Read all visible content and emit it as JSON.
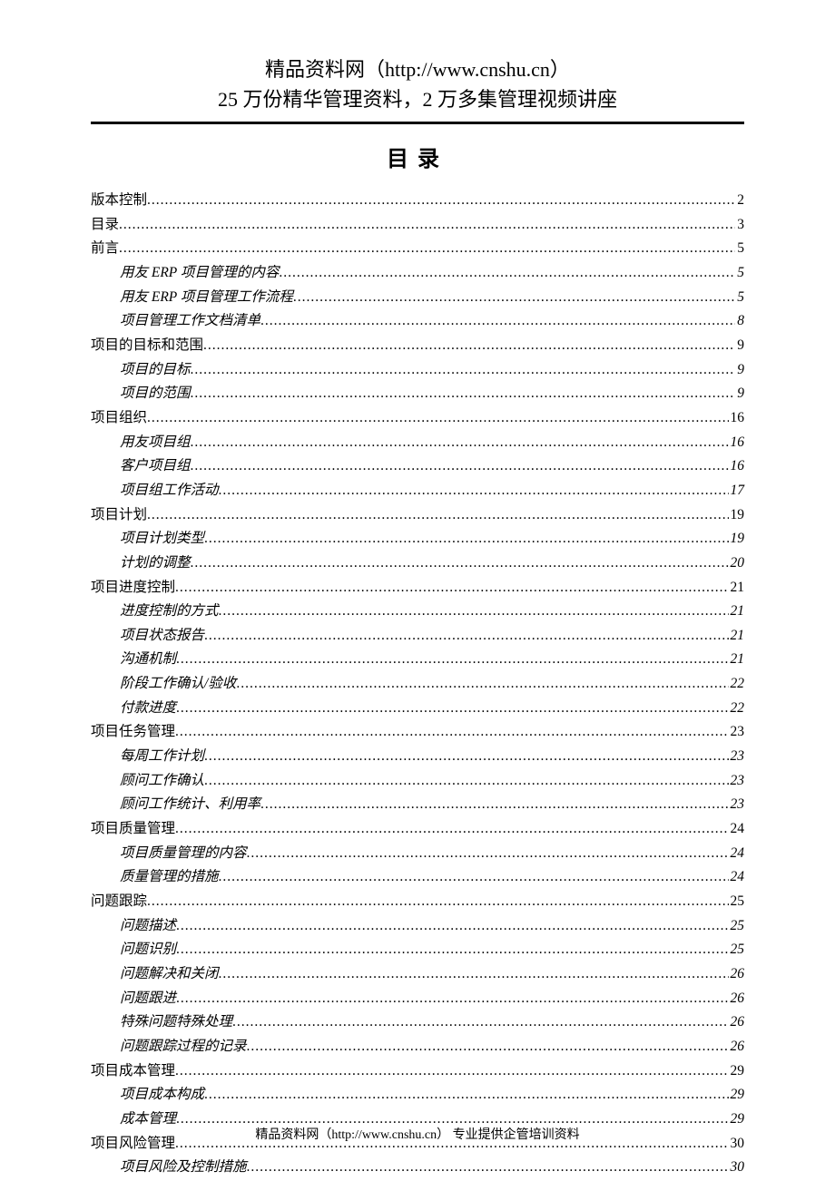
{
  "header": {
    "line1": "精品资料网（http://www.cnshu.cn）",
    "line2": "25 万份精华管理资料，2 万多集管理视频讲座"
  },
  "tocTitle": "目录",
  "toc": [
    {
      "level": 0,
      "label": "版本控制",
      "page": "2"
    },
    {
      "level": 0,
      "label": "目录",
      "page": "3"
    },
    {
      "level": 0,
      "label": "前言",
      "page": "5"
    },
    {
      "level": 1,
      "label": "用友 ERP 项目管理的内容",
      "page": "5"
    },
    {
      "level": 1,
      "label": "用友 ERP 项目管理工作流程",
      "page": "5"
    },
    {
      "level": 1,
      "label": "项目管理工作文档清单",
      "page": "8"
    },
    {
      "level": 0,
      "label": "项目的目标和范围",
      "page": "9"
    },
    {
      "level": 1,
      "label": "项目的目标",
      "page": "9"
    },
    {
      "level": 1,
      "label": "项目的范围",
      "page": "9"
    },
    {
      "level": 0,
      "label": "项目组织",
      "page": "16"
    },
    {
      "level": 1,
      "label": "用友项目组",
      "page": "16"
    },
    {
      "level": 1,
      "label": "客户项目组",
      "page": "16"
    },
    {
      "level": 1,
      "label": "项目组工作活动",
      "page": "17"
    },
    {
      "level": 0,
      "label": "项目计划",
      "page": "19"
    },
    {
      "level": 1,
      "label": "项目计划类型",
      "page": "19"
    },
    {
      "level": 1,
      "label": "计划的调整",
      "page": "20"
    },
    {
      "level": 0,
      "label": "项目进度控制",
      "page": "21"
    },
    {
      "level": 1,
      "label": "进度控制的方式",
      "page": "21"
    },
    {
      "level": 1,
      "label": "项目状态报告",
      "page": "21"
    },
    {
      "level": 1,
      "label": "沟通机制",
      "page": "21"
    },
    {
      "level": 1,
      "label": "阶段工作确认/验收",
      "page": "22"
    },
    {
      "level": 1,
      "label": "付款进度",
      "page": "22"
    },
    {
      "level": 0,
      "label": "项目任务管理",
      "page": "23"
    },
    {
      "level": 1,
      "label": "每周工作计划",
      "page": "23"
    },
    {
      "level": 1,
      "label": "顾问工作确认",
      "page": "23"
    },
    {
      "level": 1,
      "label": "顾问工作统计、利用率",
      "page": "23"
    },
    {
      "level": 0,
      "label": "项目质量管理",
      "page": "24"
    },
    {
      "level": 1,
      "label": "项目质量管理的内容",
      "page": "24"
    },
    {
      "level": 1,
      "label": "质量管理的措施",
      "page": "24"
    },
    {
      "level": 0,
      "label": "问题跟踪",
      "page": "25"
    },
    {
      "level": 1,
      "label": "问题描述",
      "page": "25"
    },
    {
      "level": 1,
      "label": "问题识别",
      "page": "25"
    },
    {
      "level": 1,
      "label": "问题解决和关闭",
      "page": "26"
    },
    {
      "level": 1,
      "label": "问题跟进",
      "page": "26"
    },
    {
      "level": 1,
      "label": "特殊问题特殊处理",
      "page": "26"
    },
    {
      "level": 1,
      "label": "问题跟踪过程的记录",
      "page": "26"
    },
    {
      "level": 0,
      "label": "项目成本管理",
      "page": "29"
    },
    {
      "level": 1,
      "label": "项目成本构成",
      "page": "29"
    },
    {
      "level": 1,
      "label": "成本管理",
      "page": "29"
    },
    {
      "level": 0,
      "label": "项目风险管理",
      "page": "30"
    },
    {
      "level": 1,
      "label": "项目风险及控制措施",
      "page": "30"
    }
  ],
  "footer": "精品资料网（http://www.cnshu.cn）  专业提供企管培训资料"
}
